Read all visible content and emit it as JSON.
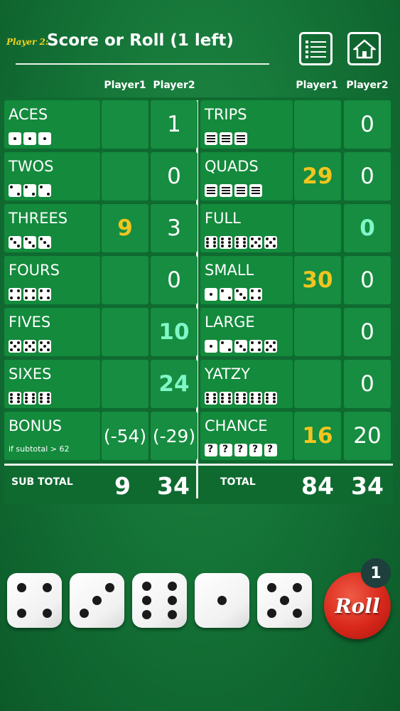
{
  "header": {
    "player_tag": "Player 2:",
    "title": "Score or Roll (1 left)"
  },
  "columns": {
    "left_p1": "Player1",
    "left_p2": "Player2",
    "right_p1": "Player1",
    "right_p2": "Player2"
  },
  "left_rows": [
    {
      "label": "ACES",
      "p1": "",
      "p2": "1",
      "p2_style": "white"
    },
    {
      "label": "TWOS",
      "p1": "",
      "p2": "0",
      "p2_style": "white"
    },
    {
      "label": "THREES",
      "p1": "9",
      "p1_style": "yellow",
      "p2": "3",
      "p2_style": "white"
    },
    {
      "label": "FOURS",
      "p1": "",
      "p2": "0",
      "p2_style": "white"
    },
    {
      "label": "FIVES",
      "p1": "",
      "p2": "10",
      "p2_style": "cyan"
    },
    {
      "label": "SIXES",
      "p1": "",
      "p2": "24",
      "p2_style": "cyan"
    },
    {
      "label": "BONUS",
      "sub": "if subtotal > 62",
      "p1": "(-54)",
      "p2": "(-29)",
      "p1_style": "white",
      "p2_style": "white"
    }
  ],
  "right_rows": [
    {
      "label": "TRIPS",
      "p1": "",
      "p2": "0",
      "p2_style": "white"
    },
    {
      "label": "QUADS",
      "p1": "29",
      "p1_style": "yellow",
      "p2": "0",
      "p2_style": "white"
    },
    {
      "label": "FULL",
      "p1": "",
      "p2": "0",
      "p2_style": "cyan"
    },
    {
      "label": "SMALL",
      "p1": "30",
      "p1_style": "yellow",
      "p2": "0",
      "p2_style": "white"
    },
    {
      "label": "LARGE",
      "p1": "",
      "p2": "0",
      "p2_style": "white"
    },
    {
      "label": "YATZY",
      "p1": "",
      "p2": "0",
      "p2_style": "white"
    },
    {
      "label": "CHANCE",
      "p1": "16",
      "p1_style": "yellow",
      "p2": "20",
      "p2_style": "white"
    }
  ],
  "subtotal": {
    "label": "SUB TOTAL",
    "p1": "9",
    "p2": "34"
  },
  "total": {
    "label": "TOTAL",
    "p1": "84",
    "p2": "34"
  },
  "dice": [
    4,
    3,
    6,
    1,
    5
  ],
  "roll": {
    "label": "Roll",
    "rolls_left": "1"
  },
  "colors": {
    "felt": "#137035",
    "cell": "#138a3c",
    "yellow": "#f2c51f",
    "cyan": "#7ff7c6",
    "roll_red": "#d8271b"
  }
}
